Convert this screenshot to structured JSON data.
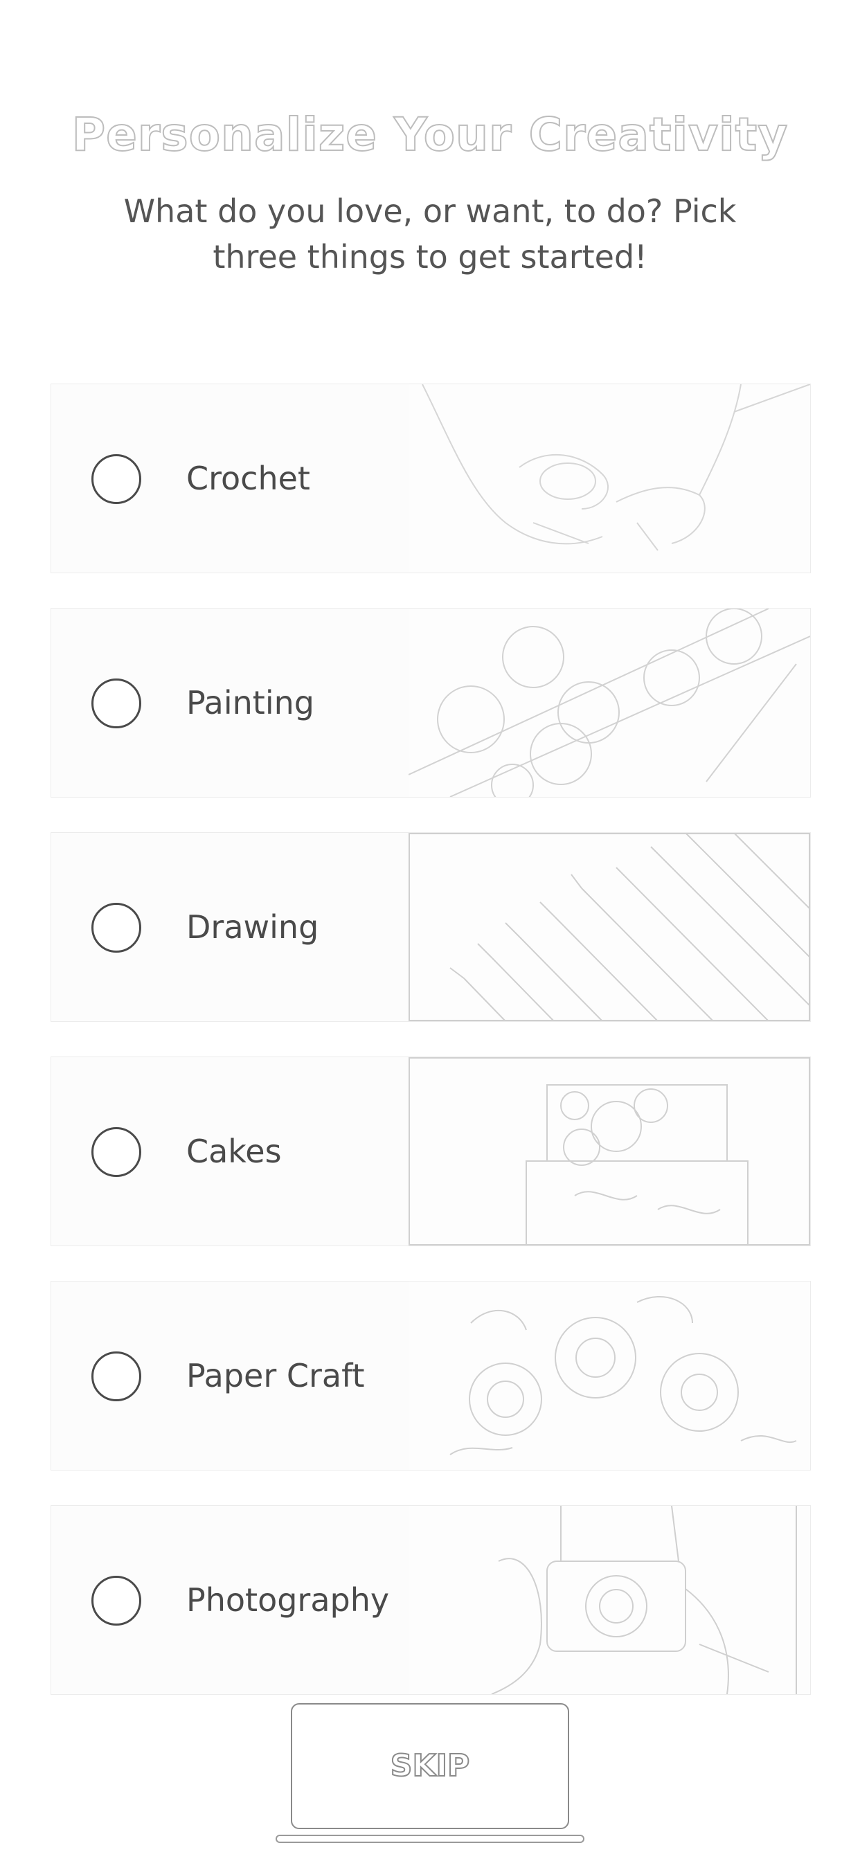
{
  "header": {
    "title": "Personalize Your Creativity",
    "subtitle": "What do you love, or want, to do? Pick three things to get started!"
  },
  "options": [
    {
      "label": "Crochet",
      "icon": "crochet-image",
      "selected": false
    },
    {
      "label": "Painting",
      "icon": "painting-image",
      "selected": false
    },
    {
      "label": "Drawing",
      "icon": "drawing-image",
      "selected": false
    },
    {
      "label": "Cakes",
      "icon": "cakes-image",
      "selected": false
    },
    {
      "label": "Paper Craft",
      "icon": "paper-craft-image",
      "selected": false
    },
    {
      "label": "Photography",
      "icon": "photography-image",
      "selected": false
    }
  ],
  "footer": {
    "skip_label": "SKIP"
  },
  "colors": {
    "text": "#4a4a4a",
    "outline": "#bdbdbd",
    "border": "#ececec"
  }
}
